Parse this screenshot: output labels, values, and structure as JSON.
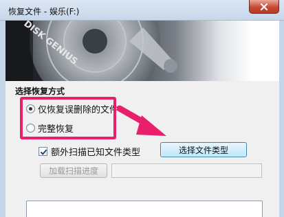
{
  "window": {
    "title": "恢复文件 - 娱乐(F:)",
    "close_icon": "close-icon"
  },
  "banner": {
    "logo_text": "DISK GENIUS",
    "image": "hard-disk-platter"
  },
  "recovery_mode": {
    "section_title": "选择恢复方式",
    "options": [
      {
        "label": "仅恢复误删除的文件",
        "checked": true
      },
      {
        "label": "完整恢复",
        "checked": false
      }
    ]
  },
  "scan_options": {
    "extra_scan_label": "额外扫描已知文件类型",
    "extra_scan_checked": true,
    "select_type_button": "选择文件类型",
    "load_progress_button": "加载扫描进度",
    "load_progress_enabled": false,
    "progress_path_value": ""
  },
  "annotation": {
    "highlight_color": "#e8206c",
    "arrow_color": "#e8206c"
  }
}
